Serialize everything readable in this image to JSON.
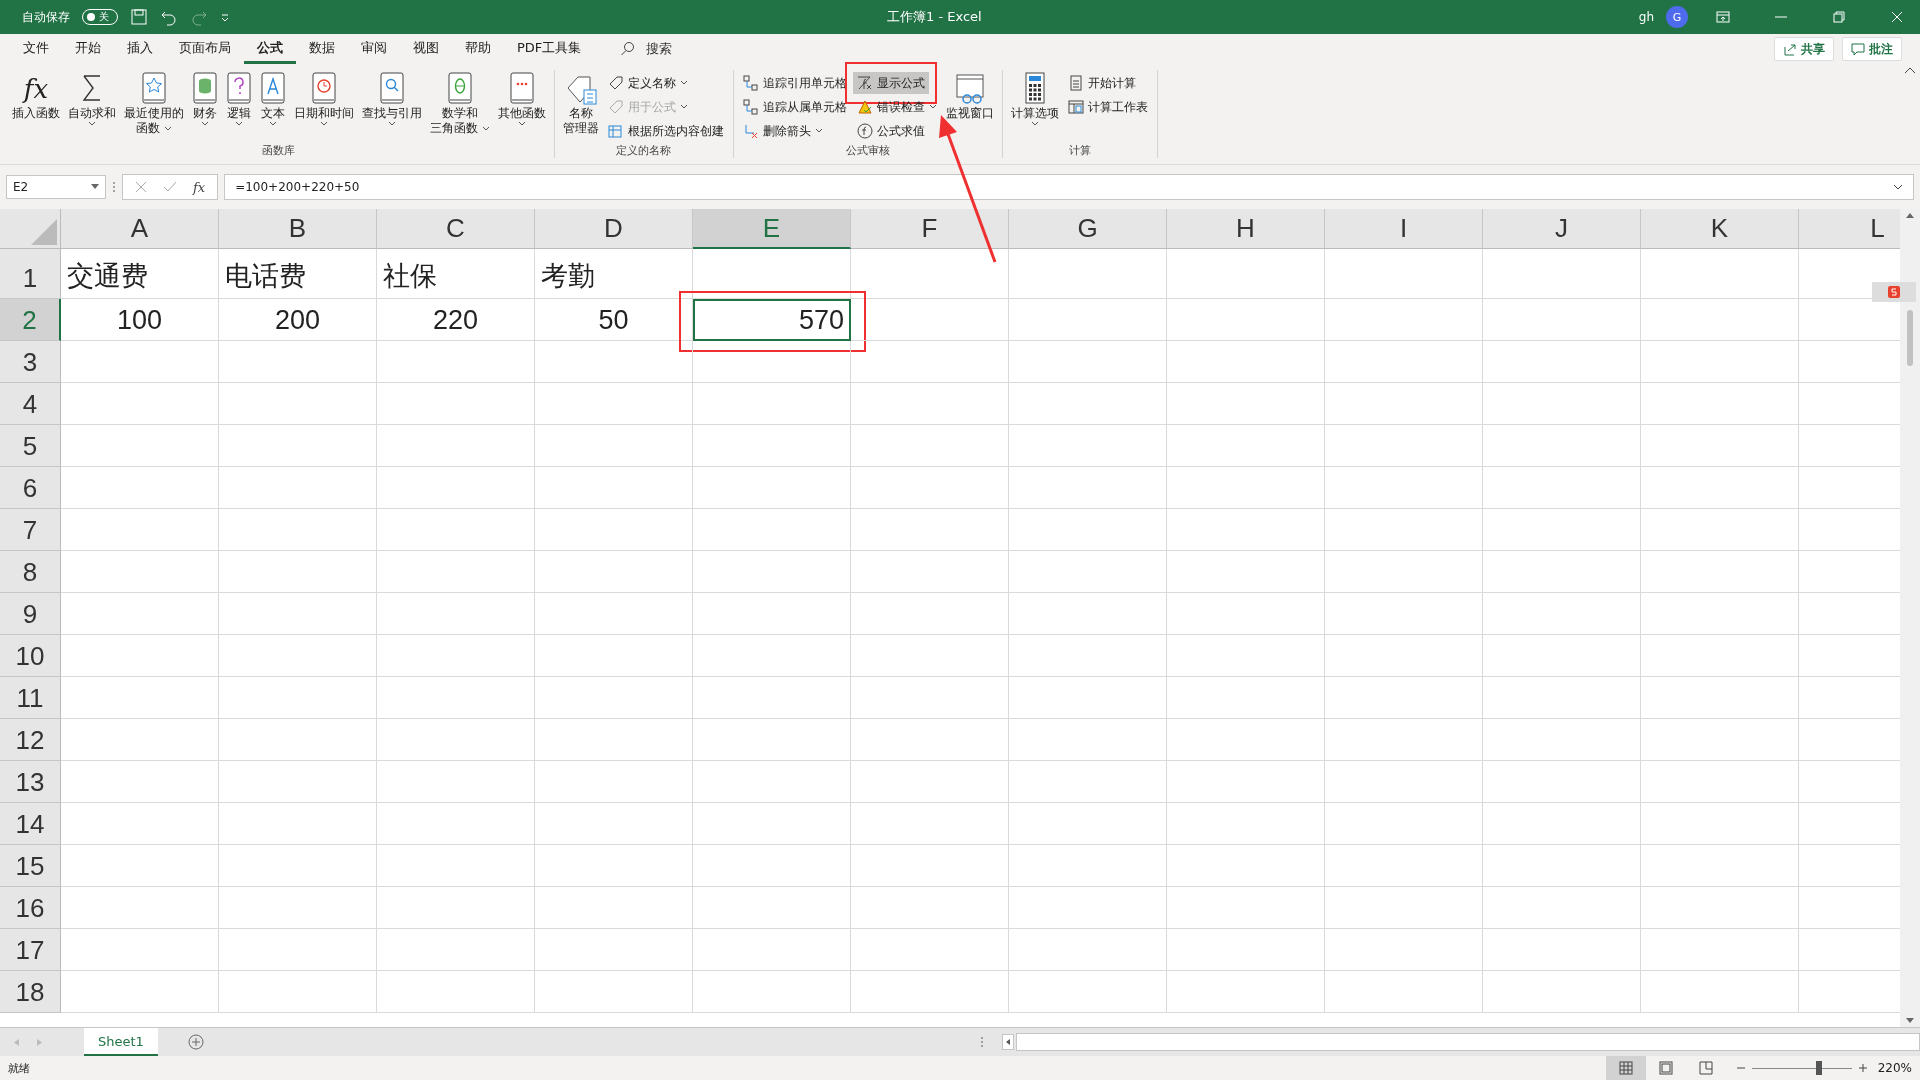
{
  "title_bar": {
    "autosave_label": "自动保存",
    "autosave": {
      "on": false,
      "label": "关"
    },
    "title": "工作簿1  -  Excel",
    "user": "gh",
    "avatar": "G"
  },
  "tabs": [
    {
      "label": "文件",
      "selected": false
    },
    {
      "label": "开始",
      "selected": false
    },
    {
      "label": "插入",
      "selected": false
    },
    {
      "label": "页面布局",
      "selected": false
    },
    {
      "label": "公式",
      "selected": true
    },
    {
      "label": "数据",
      "selected": false
    },
    {
      "label": "审阅",
      "selected": false
    },
    {
      "label": "视图",
      "selected": false
    },
    {
      "label": "帮助",
      "selected": false
    },
    {
      "label": "PDF工具集",
      "selected": false
    }
  ],
  "search": {
    "label": "搜索"
  },
  "share_buttons": [
    "共享",
    "批注"
  ],
  "ribbon_groups": [
    {
      "label": "函数库",
      "items": [
        {
          "kind": "large",
          "glyph": "fx",
          "lines": [
            "插入函数"
          ],
          "dropdown": false
        },
        {
          "kind": "large",
          "lines": [
            "自动求和"
          ],
          "dropdown": true
        },
        {
          "kind": "large",
          "lines": [
            "最近使用的",
            "函数"
          ],
          "dropdown": true
        },
        {
          "kind": "large",
          "lines": [
            "财务"
          ],
          "dropdown": true
        },
        {
          "kind": "large",
          "lines": [
            "逻辑"
          ],
          "dropdown": true
        },
        {
          "kind": "large",
          "lines": [
            "文本"
          ],
          "dropdown": true
        },
        {
          "kind": "large",
          "lines": [
            "日期和时间"
          ],
          "dropdown": true
        },
        {
          "kind": "large",
          "lines": [
            "查找与引用"
          ],
          "dropdown": true
        },
        {
          "kind": "large",
          "lines": [
            "数学和",
            "三角函数"
          ],
          "dropdown": true
        },
        {
          "kind": "large",
          "lines": [
            "其他函数"
          ],
          "dropdown": true
        }
      ]
    },
    {
      "label": "定义的名称",
      "items": [
        {
          "kind": "large",
          "lines": [
            "名称",
            "管理器"
          ],
          "dropdown": false
        },
        {
          "kind": "column",
          "buttons": [
            {
              "label": "定义名称",
              "dropdown": true,
              "disabled": false,
              "selected": false,
              "highlighted": false
            },
            {
              "label": "用于公式",
              "dropdown": true,
              "disabled": true,
              "selected": false,
              "highlighted": false
            },
            {
              "label": "根据所选内容创建",
              "dropdown": false,
              "disabled": false,
              "selected": false,
              "highlighted": false
            }
          ]
        }
      ]
    },
    {
      "label": "公式审核",
      "items": [
        {
          "kind": "column",
          "buttons": [
            {
              "label": "追踪引用单元格",
              "dropdown": false,
              "disabled": false,
              "selected": false,
              "highlighted": false
            },
            {
              "label": "追踪从属单元格",
              "dropdown": false,
              "disabled": false,
              "selected": false,
              "highlighted": false
            },
            {
              "label": "删除箭头",
              "dropdown": true,
              "disabled": false,
              "selected": false,
              "highlighted": false
            }
          ]
        },
        {
          "kind": "column",
          "buttons": [
            {
              "label": "显示公式",
              "dropdown": false,
              "disabled": false,
              "selected": true,
              "highlighted": true
            },
            {
              "label": "错误检查",
              "dropdown": true,
              "disabled": false,
              "selected": false,
              "highlighted": false
            },
            {
              "label": "公式求值",
              "dropdown": false,
              "disabled": false,
              "selected": false,
              "highlighted": false
            }
          ]
        },
        {
          "kind": "large",
          "lines": [
            "监视窗口"
          ],
          "dropdown": false
        }
      ]
    },
    {
      "label": "计算",
      "items": [
        {
          "kind": "large",
          "lines": [
            "计算选项"
          ],
          "dropdown": true
        },
        {
          "kind": "column",
          "buttons": [
            {
              "label": "开始计算",
              "dropdown": false,
              "disabled": false,
              "selected": false,
              "highlighted": false
            },
            {
              "label": "计算工作表",
              "dropdown": false,
              "disabled": false,
              "selected": false,
              "highlighted": false
            }
          ]
        }
      ]
    }
  ],
  "formula_bar": {
    "name_box": "E2",
    "fx_label": "fx",
    "formula": "=100+200+220+50"
  },
  "columns": [
    {
      "label": "A",
      "selected": false
    },
    {
      "label": "B",
      "selected": false
    },
    {
      "label": "C",
      "selected": false
    },
    {
      "label": "D",
      "selected": false
    },
    {
      "label": "E",
      "selected": true
    },
    {
      "label": "F",
      "selected": false
    },
    {
      "label": "G",
      "selected": false
    },
    {
      "label": "H",
      "selected": false
    },
    {
      "label": "I",
      "selected": false
    },
    {
      "label": "J",
      "selected": false
    },
    {
      "label": "K",
      "selected": false
    },
    {
      "label": "L",
      "selected": false
    }
  ],
  "rows": [
    {
      "label": "1",
      "selected": false,
      "cells": [
        {
          "text": "交通费",
          "kind": "text",
          "selected": false,
          "highlighted": false
        },
        {
          "text": "电话费",
          "kind": "text",
          "selected": false,
          "highlighted": false
        },
        {
          "text": "社保",
          "kind": "text",
          "selected": false,
          "highlighted": false
        },
        {
          "text": "考勤",
          "kind": "text",
          "selected": false,
          "highlighted": false
        }
      ]
    },
    {
      "label": "2",
      "selected": true,
      "cells": [
        {
          "text": "100",
          "kind": "number",
          "selected": false,
          "highlighted": false
        },
        {
          "text": "200",
          "kind": "number",
          "selected": false,
          "highlighted": false
        },
        {
          "text": "220",
          "kind": "number",
          "selected": false,
          "highlighted": false
        },
        {
          "text": "50",
          "kind": "number",
          "selected": false,
          "highlighted": false
        },
        {
          "text": "570",
          "kind": "formula",
          "selected": true,
          "highlighted": true
        }
      ]
    },
    {
      "label": "3",
      "selected": false
    },
    {
      "label": "4",
      "selected": false
    },
    {
      "label": "5",
      "selected": false
    },
    {
      "label": "6",
      "selected": false
    },
    {
      "label": "7",
      "selected": false
    },
    {
      "label": "8",
      "selected": false
    },
    {
      "label": "9",
      "selected": false
    },
    {
      "label": "10",
      "selected": false
    },
    {
      "label": "11",
      "selected": false
    },
    {
      "label": "12",
      "selected": false
    },
    {
      "label": "13",
      "selected": false
    },
    {
      "label": "14",
      "selected": false
    },
    {
      "label": "15",
      "selected": false
    },
    {
      "label": "16",
      "selected": false
    },
    {
      "label": "17",
      "selected": false
    },
    {
      "label": "18",
      "selected": false
    }
  ],
  "sheets": [
    {
      "label": "Sheet1",
      "selected": true
    }
  ],
  "status_bar": {
    "status": "就绪",
    "views": [
      {
        "selected": true
      },
      {
        "selected": false
      },
      {
        "selected": false
      }
    ],
    "zoom": {
      "level": 0.67,
      "label": "220%"
    }
  }
}
